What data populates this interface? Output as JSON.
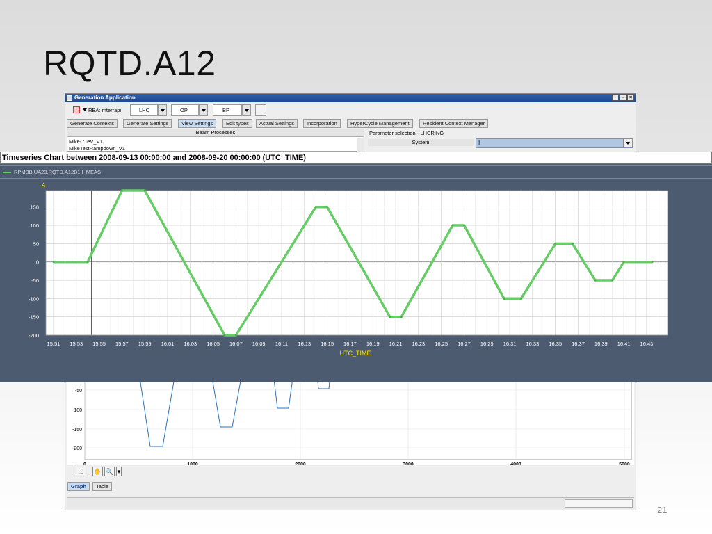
{
  "slide": {
    "title": "RQTD.A12",
    "number": "21"
  },
  "app": {
    "title": "Generation Application",
    "toolbar": {
      "rba": "RBA: mterrapi",
      "machine": "LHC",
      "mode": "OP",
      "context": "BP"
    },
    "tabs": [
      "Generate Contexts",
      "Generate Settings",
      "View Settings",
      "Edit types",
      "Actual Settings",
      "Incorporation",
      "HyperCycle Management",
      "Resident Context Manager"
    ],
    "active_tab": "View Settings",
    "beam_processes": {
      "header": "Beam Processes",
      "items": [
        "Mike-7TeV_V1",
        "MikeTestRampdown_V1"
      ]
    },
    "parameter_selection": {
      "title": "Parameter selection - LHCRING",
      "system_header": "System",
      "system_value": "I"
    },
    "lower_plot": {
      "y_ticks": [
        "-50",
        "-100",
        "-150",
        "-200"
      ],
      "x_ticks": [
        "0",
        "1000",
        "2000",
        "3000",
        "4000",
        "5000"
      ],
      "series_color": "#2a73b8"
    },
    "view_tabs": [
      "Graph",
      "Table"
    ],
    "active_view_tab": "Graph",
    "tool_icons": [
      "zoom-fit-icon",
      "hand-pan-icon",
      "magnifier-icon",
      "dropdown-icon"
    ]
  },
  "chart_data": {
    "type": "line",
    "title": "Timeseries Chart between 2008-09-13 00:00:00 and 2008-09-20 00:00:00 (UTC_TIME)",
    "xlabel": "UTC_TIME",
    "ylabel": "A",
    "ylim": [
      -200,
      200
    ],
    "y_ticks": [
      150,
      100,
      50,
      0,
      -50,
      -100,
      -150,
      -200
    ],
    "x_tick_labels": [
      "15:51",
      "15:53",
      "15:55",
      "15:57",
      "15:59",
      "16:01",
      "16:03",
      "16:05",
      "16:07",
      "16:09",
      "16:11",
      "16:13",
      "16:15",
      "16:17",
      "16:19",
      "16:21",
      "16:23",
      "16:25",
      "16:27",
      "16:29",
      "16:31",
      "16:33",
      "16:35",
      "16:37",
      "16:39",
      "16:41",
      "16:43"
    ],
    "grid": true,
    "legend_position": "top-left",
    "series": [
      {
        "name": "RPMBB.UA23.RQTD.A12B1:I_MEAS",
        "color": "#66cc66",
        "x": [
          "15:51:00",
          "15:54:00",
          "15:57:00",
          "15:59:00",
          "16:06:00",
          "16:07:00",
          "16:14:00",
          "16:15:00",
          "16:20:30",
          "16:21:30",
          "16:26:00",
          "16:27:00",
          "16:30:30",
          "16:32:00",
          "16:35:00",
          "16:36:30",
          "16:38:30",
          "16:40:00",
          "16:41:00",
          "16:43:30"
        ],
        "y": [
          0,
          0,
          195,
          195,
          -200,
          -200,
          150,
          150,
          -150,
          -150,
          100,
          100,
          -100,
          -100,
          50,
          50,
          -50,
          -50,
          0,
          0
        ]
      }
    ]
  }
}
